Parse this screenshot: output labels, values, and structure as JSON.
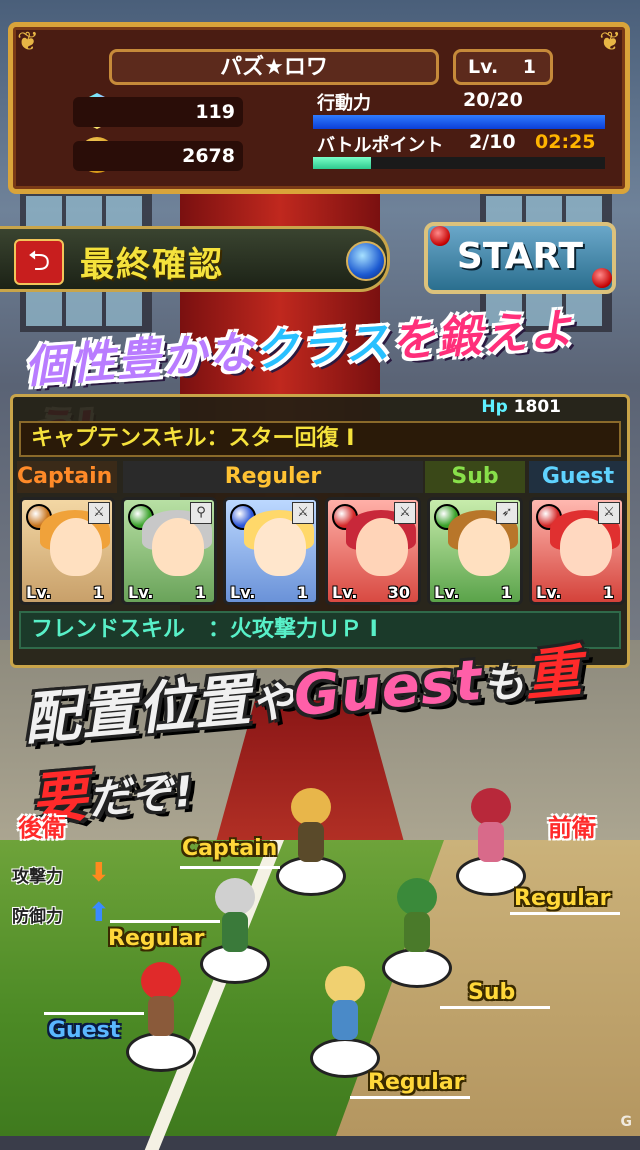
{
  "player": {
    "name": "パズ★ロワ",
    "level_label": "Lv.",
    "level": "1"
  },
  "currency": {
    "gems": "119",
    "coins": "2678"
  },
  "ap": {
    "label": "行動力",
    "value": "20/20",
    "fraction": 1.0,
    "color": "#1e5cf0"
  },
  "bp": {
    "label": "バトルポイント",
    "value": "2/10",
    "timer": "02:25",
    "fraction": 0.2,
    "color": "#2ec98f"
  },
  "confirm": {
    "title": "最終確認",
    "back_icon": "back-arrow-icon",
    "start_label": "START"
  },
  "banner1": {
    "part1": "個性豊かな",
    "part2": "クラス",
    "part3": "を鍛えよう!"
  },
  "party": {
    "hp_label": "Hp",
    "hp": "1801",
    "captain_skill": "キャプテンスキル：スター回復 I",
    "headers": {
      "captain": "Captain",
      "regular": "Reguler",
      "sub": "Sub",
      "guest": "Guest"
    },
    "members": [
      {
        "level_label": "Lv.",
        "level": "1",
        "element": "#c8751e",
        "weapon_icon": "sword-icon"
      },
      {
        "level_label": "Lv.",
        "level": "1",
        "element": "#3aa12a",
        "weapon_icon": "staff-icon"
      },
      {
        "level_label": "Lv.",
        "level": "1",
        "element": "#2a55d8",
        "weapon_icon": "sword-icon"
      },
      {
        "level_label": "Lv.",
        "level": "30",
        "element": "#d42a2a",
        "weapon_icon": "sword-icon"
      },
      {
        "level_label": "Lv.",
        "level": "1",
        "element": "#3aa12a",
        "weapon_icon": "bow-icon"
      },
      {
        "level_label": "Lv.",
        "level": "1",
        "element": "#d42a2a",
        "weapon_icon": "sword-icon"
      }
    ],
    "friend_skill_label": "フレンドスキル",
    "friend_skill": "：火攻撃力ＵＰ I"
  },
  "banner2": {
    "part1": "配置位置",
    "part2": "や",
    "part3": "Guest",
    "part4": "も",
    "part5": "重要",
    "part6": "だぞ!"
  },
  "formation": {
    "rear": "後衛",
    "front": "前衛",
    "attack": "攻撃力",
    "defense": "防御力",
    "attack_arrow": "down-arrow-icon",
    "defense_arrow": "up-arrow-icon",
    "labels": {
      "captain": "Captain",
      "regular1": "Regular",
      "guest": "Guest",
      "regular2": "Regular",
      "sub": "Sub",
      "regular3": "Regular"
    }
  },
  "copyright": "G"
}
